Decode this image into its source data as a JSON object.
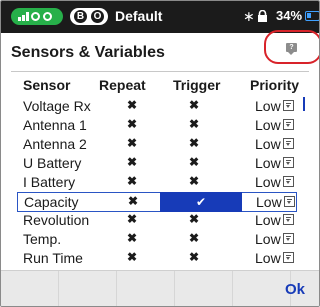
{
  "status": {
    "model_name": "Default",
    "b_label": "B",
    "o_label": "O",
    "battery_pct": "34%",
    "bluetooth_icon": "bluetooth-icon",
    "lock_icon": "lock-icon",
    "signal_color": "#27b04a",
    "battery_color": "#3fa0ff"
  },
  "page": {
    "title": "Sensors & Variables",
    "help_icon": "help-chat-icon"
  },
  "table": {
    "headers": {
      "sensor": "Sensor",
      "repeat": "Repeat",
      "trigger": "Trigger",
      "priority": "Priority"
    },
    "rows": [
      {
        "sensor": "Voltage Rx",
        "repeat": "✖",
        "trigger": "✖",
        "priority": "Low"
      },
      {
        "sensor": "Antenna 1",
        "repeat": "✖",
        "trigger": "✖",
        "priority": "Low"
      },
      {
        "sensor": "Antenna 2",
        "repeat": "✖",
        "trigger": "✖",
        "priority": "Low"
      },
      {
        "sensor": "U Battery",
        "repeat": "✖",
        "trigger": "✖",
        "priority": "Low"
      },
      {
        "sensor": "I Battery",
        "repeat": "✖",
        "trigger": "✖",
        "priority": "Low"
      },
      {
        "sensor": "Capacity",
        "repeat": "✖",
        "trigger": "✔",
        "priority": "Low",
        "selected": true
      },
      {
        "sensor": "Revolution",
        "repeat": "✖",
        "trigger": "✖",
        "priority": "Low"
      },
      {
        "sensor": "Temp.",
        "repeat": "✖",
        "trigger": "✖",
        "priority": "Low"
      },
      {
        "sensor": "Run Time",
        "repeat": "✖",
        "trigger": "✖",
        "priority": "Low"
      }
    ]
  },
  "footer": {
    "ok_label": "Ok"
  },
  "colors": {
    "accent": "#173bb8",
    "annotation": "#d8232a"
  }
}
